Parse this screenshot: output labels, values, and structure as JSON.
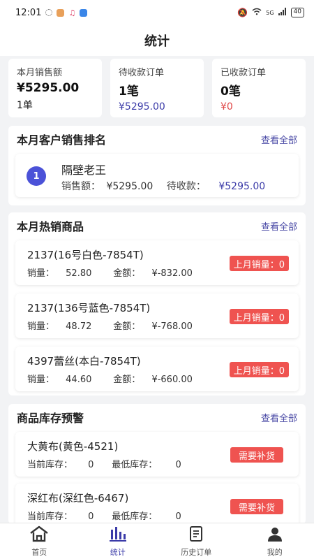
{
  "status_bar": {
    "time": "12:01",
    "network": "5G",
    "battery": "40"
  },
  "header": {
    "title": "统计"
  },
  "summary": [
    {
      "label": "本月销售额",
      "value": "¥5295.00",
      "sub": "1单"
    },
    {
      "label": "待收款订单",
      "value": "1笔",
      "sub": "¥5295.00"
    },
    {
      "label": "已收款订单",
      "value": "0笔",
      "sub": "¥0"
    }
  ],
  "ranking": {
    "title": "本月客户销售排名",
    "more": "查看全部",
    "items": [
      {
        "rank": "1",
        "name": "隔壁老王",
        "sales_label": "销售额：",
        "sales": "¥5295.00",
        "pending_label": "待收款：",
        "pending": "¥5295.00"
      }
    ]
  },
  "hot": {
    "title": "本月热销商品",
    "more": "查看全部",
    "items": [
      {
        "name": "2137(16号白色-7854T)",
        "qty_label": "销量：",
        "qty": "52.80",
        "amount_label": "金额：",
        "amount": "¥-832.00",
        "tag": "上月销量：0"
      },
      {
        "name": "2137(136号蓝色-7854T)",
        "qty_label": "销量：",
        "qty": "48.72",
        "amount_label": "金额：",
        "amount": "¥-768.00",
        "tag": "上月销量：0"
      },
      {
        "name": "4397蕾丝(本白-7854T)",
        "qty_label": "销量：",
        "qty": "44.60",
        "amount_label": "金额：",
        "amount": "¥-660.00",
        "tag": "上月销量：0"
      }
    ]
  },
  "stock": {
    "title": "商品库存预警",
    "more": "查看全部",
    "items": [
      {
        "name": "大黄布(黄色-4521)",
        "cur_label": "当前库存：",
        "cur": "0",
        "min_label": "最低库存：",
        "min": "0",
        "tag": "需要补货"
      },
      {
        "name": "深红布(深红色-6467)",
        "cur_label": "当前库存：",
        "cur": "0",
        "min_label": "最低库存：",
        "min": "0",
        "tag": "需要补货"
      }
    ]
  },
  "nav": [
    {
      "label": "首页",
      "icon": "home-icon"
    },
    {
      "label": "统计",
      "icon": "chart-icon",
      "active": true
    },
    {
      "label": "历史订单",
      "icon": "order-history-icon"
    },
    {
      "label": "我的",
      "icon": "user-icon"
    }
  ]
}
